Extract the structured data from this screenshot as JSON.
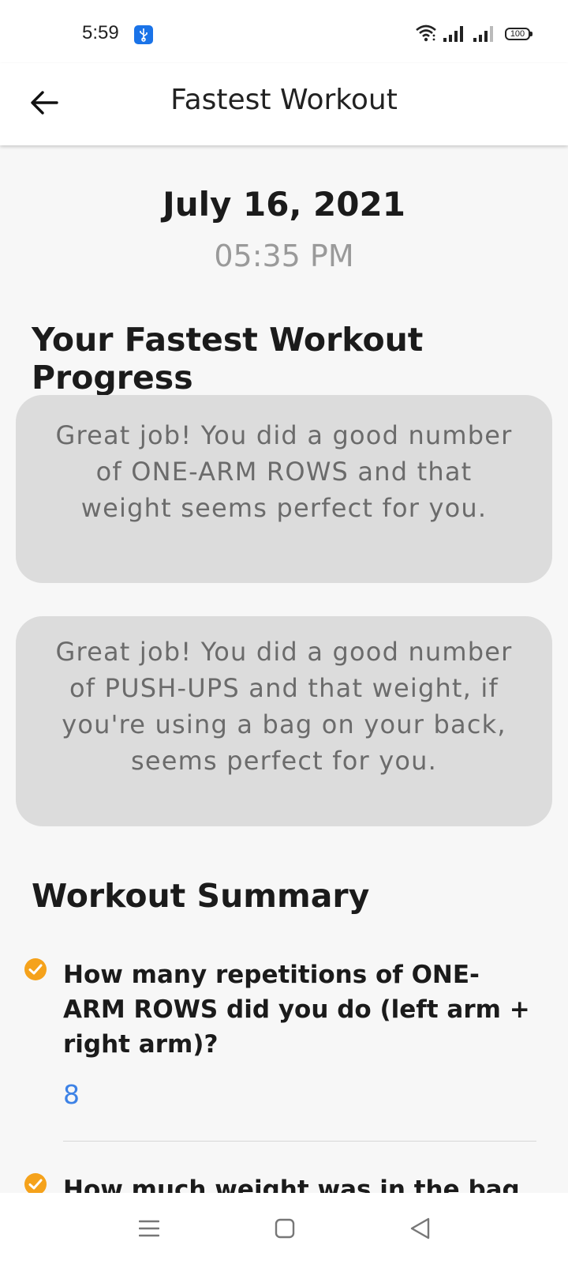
{
  "status_bar": {
    "time": "5:59",
    "battery": "100"
  },
  "header": {
    "title": "Fastest Workout"
  },
  "session": {
    "date": "July 16, 2021",
    "time": "05:35 PM"
  },
  "progress": {
    "heading": "Your Fastest Workout Progress",
    "messages": [
      "Great job! You did a good number of ONE-ARM ROWS and that weight seems perfect for you.",
      "Great job! You did a good number of PUSH-UPS and that weight, if you're using a bag on your back, seems perfect for you."
    ]
  },
  "summary": {
    "heading": "Workout Summary",
    "items": [
      {
        "question": "How many repetitions of ONE-ARM ROWS did you do (left arm + right arm)?",
        "answer": "8"
      },
      {
        "question": "How much weight was in the bag you",
        "answer": ""
      }
    ]
  },
  "colors": {
    "accent_check": "#f5a21b",
    "answer_blue": "#3d82e6",
    "card_bg": "#dcdcdc"
  },
  "icons": {
    "back": "arrow-left-icon",
    "check": "check-circle-icon",
    "nav_menu": "menu-icon",
    "nav_home": "square-icon",
    "nav_back": "triangle-back-icon"
  }
}
